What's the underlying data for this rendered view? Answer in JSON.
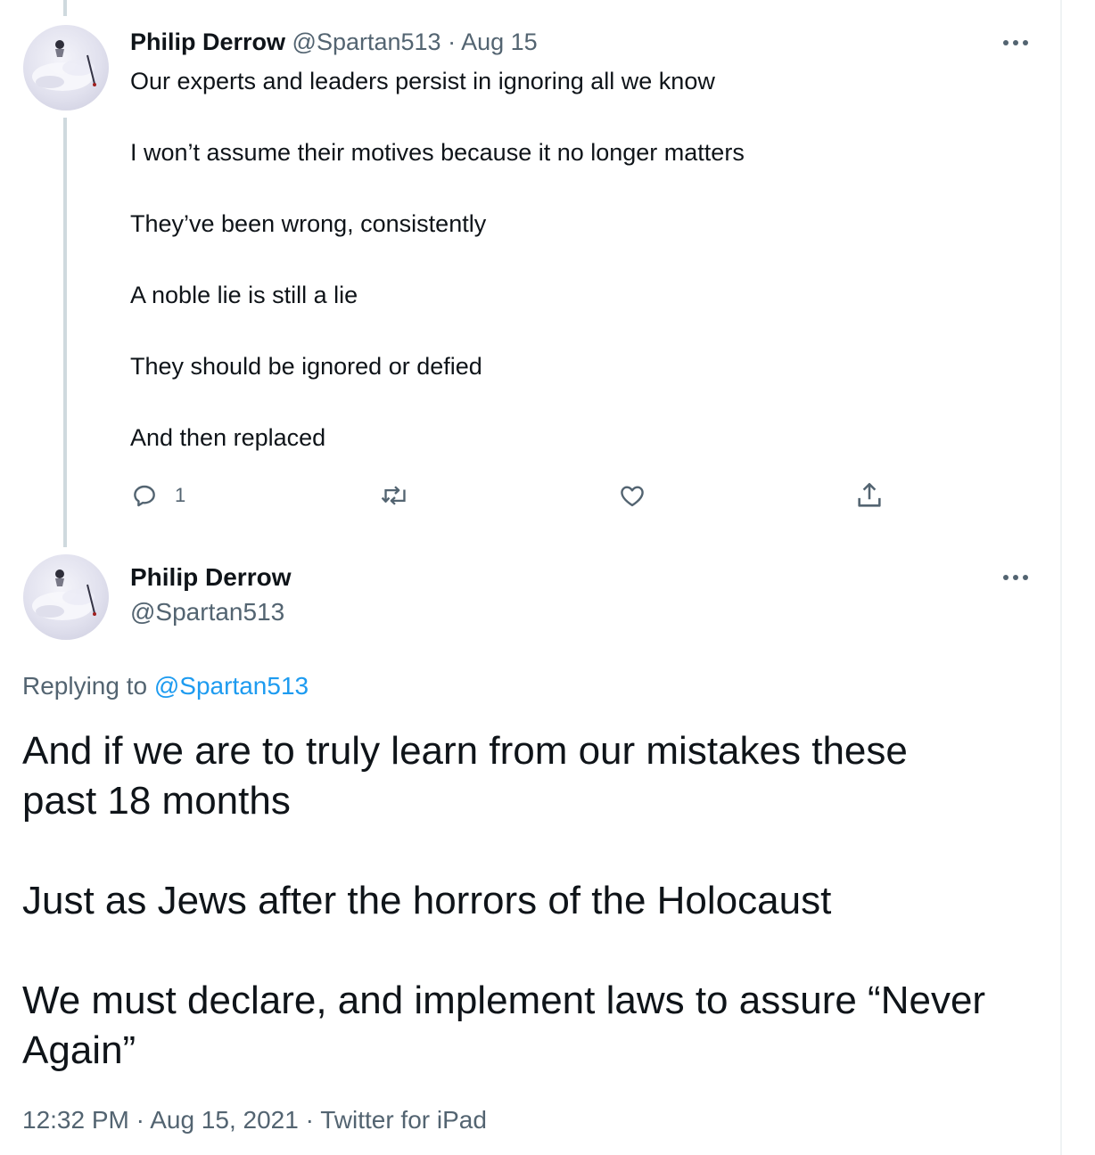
{
  "tweet1": {
    "author_name": "Philip Derrow",
    "handle": "@Spartan513",
    "separator": "·",
    "date": "Aug 15",
    "lines": [
      "Our experts and leaders persist in ignoring all we know",
      "I won’t assume their motives because it no longer matters",
      "They’ve been wrong, consistently",
      "A noble lie is still a lie",
      "They should be ignored or defied",
      "And then replaced"
    ],
    "actions": {
      "reply_icon": "reply-icon",
      "reply_count": "1",
      "retweet_icon": "retweet-icon",
      "like_icon": "heart-icon",
      "share_icon": "share-icon"
    },
    "more_icon": "more-icon"
  },
  "tweet2": {
    "author_name": "Philip Derrow",
    "handle": "@Spartan513",
    "replying_label": "Replying to",
    "replying_to": "@Spartan513",
    "lines": [
      "And if we are to truly learn from our mistakes these",
      "past 18 months",
      "Just as Jews after the horrors of the Holocaust",
      "We must declare, and implement laws to assure “Never",
      "Again”"
    ],
    "time": "12:32 PM",
    "separator": "·",
    "full_date": "Aug 15, 2021",
    "source": "Twitter for iPad",
    "more_icon": "more-icon"
  },
  "colors": {
    "text": "#0f1419",
    "muted": "#536471",
    "link": "#1d9bf0",
    "thread_line": "#cfd9de"
  }
}
